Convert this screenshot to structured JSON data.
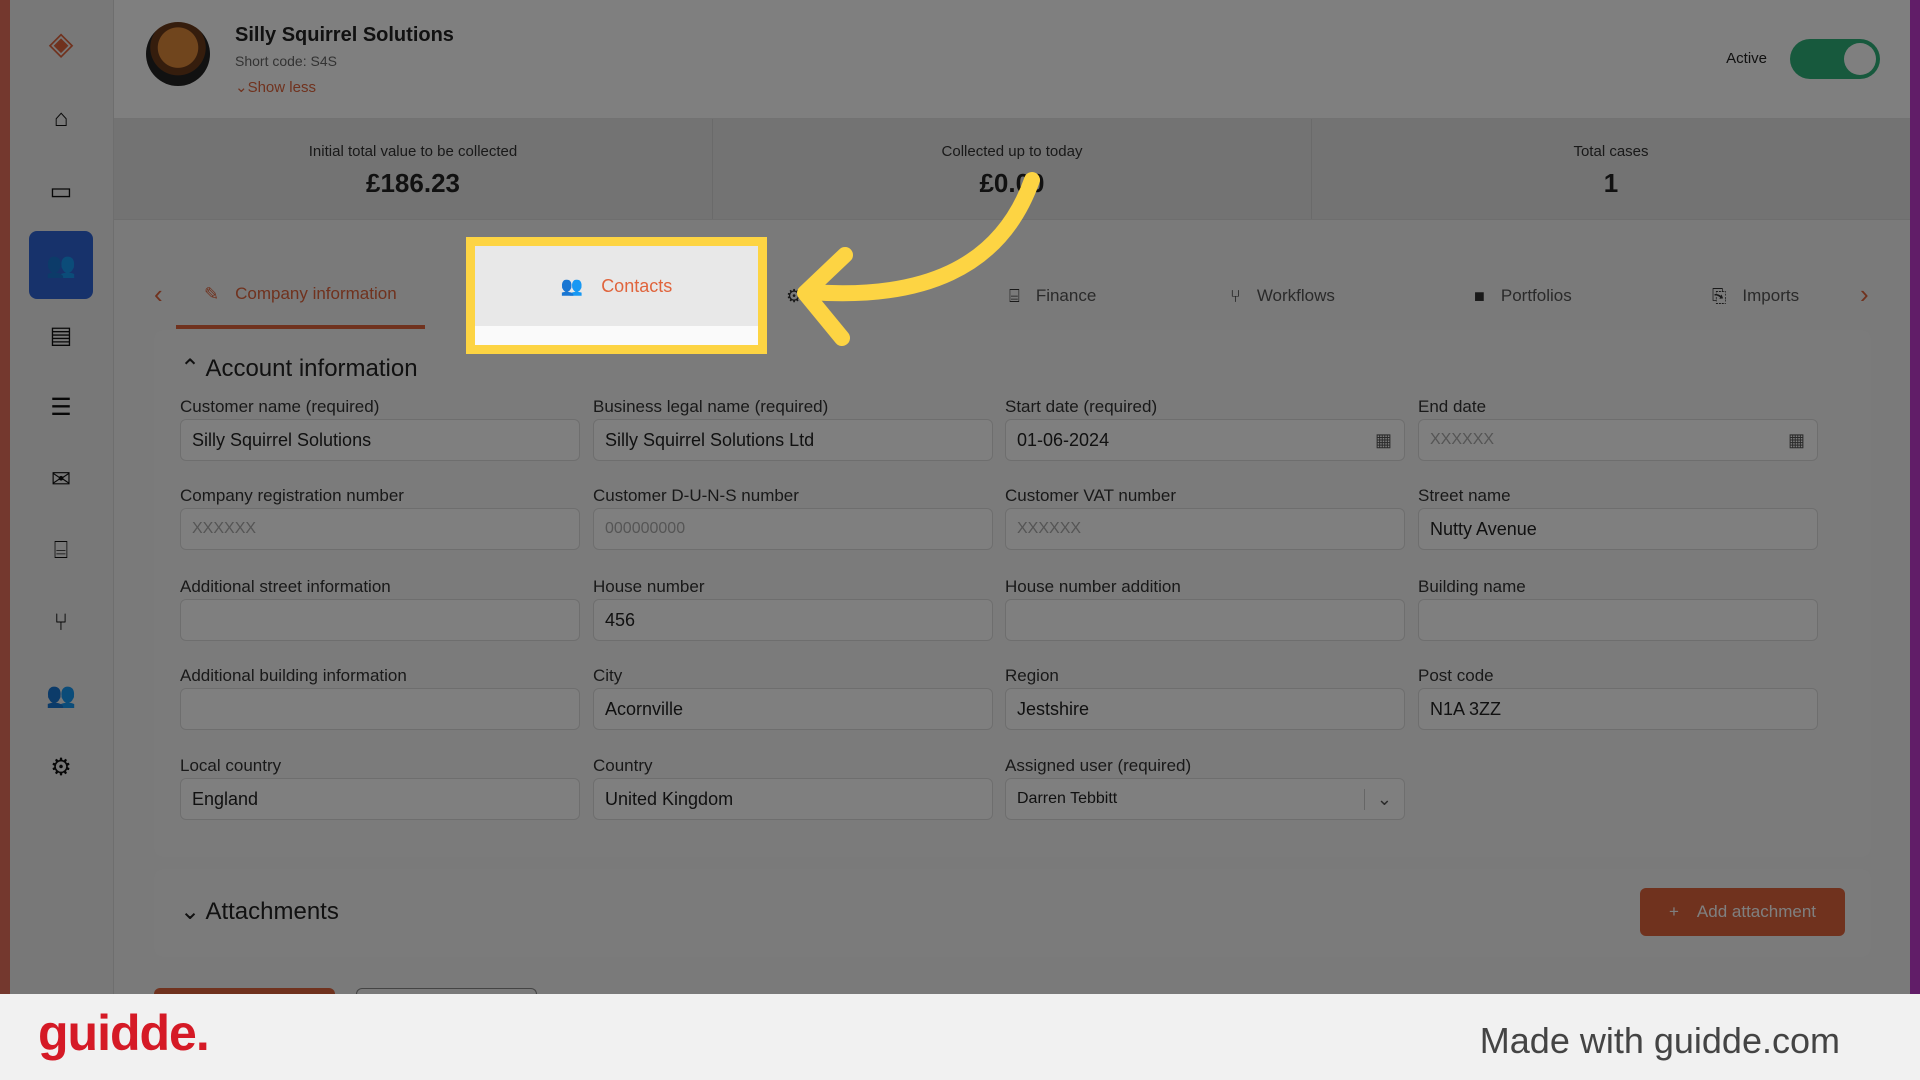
{
  "sidebar": {
    "items": [
      {
        "icon": "logo-icon"
      },
      {
        "icon": "home-icon"
      },
      {
        "icon": "ticket-icon"
      },
      {
        "icon": "users-icon",
        "active": true
      },
      {
        "icon": "contact-card-icon"
      },
      {
        "icon": "database-icon"
      },
      {
        "icon": "envelope-icon"
      },
      {
        "icon": "bank-icon"
      },
      {
        "icon": "branch-icon"
      },
      {
        "icon": "user-group-icon"
      },
      {
        "icon": "gear-icon"
      }
    ]
  },
  "header": {
    "company_name": "Silly Squirrel Solutions",
    "short_code": "Short code: S4S",
    "show_less": "Show less",
    "status_label": "Active",
    "status_on": true
  },
  "stats": [
    {
      "label": "Initial total value to be collected",
      "value": "£186.23"
    },
    {
      "label": "Collected up to today",
      "value": "£0.00"
    },
    {
      "label": "Total cases",
      "value": "1"
    }
  ],
  "tabs": [
    {
      "label": "Company information",
      "icon": "edit-doc-icon",
      "selected": true
    },
    {
      "label": "Contacts",
      "icon": "users-gear-icon"
    },
    {
      "label": "",
      "icon": "gear-icon"
    },
    {
      "label": "Finance",
      "icon": "bank-icon"
    },
    {
      "label": "Workflows",
      "icon": "branch-icon"
    },
    {
      "label": "Portfolios",
      "icon": "folder-icon"
    },
    {
      "label": "Imports",
      "icon": "file-import-icon"
    }
  ],
  "account": {
    "title": "Account information",
    "fields": [
      {
        "label": "Customer name (required)",
        "value": "Silly Squirrel Solutions"
      },
      {
        "label": "Business legal name (required)",
        "value": "Silly Squirrel Solutions Ltd"
      },
      {
        "label": "Start date (required)",
        "value": "01-06-2024"
      },
      {
        "label": "End date",
        "placeholder": "XXXXXX"
      },
      {
        "label": "Company registration number",
        "placeholder": "XXXXXX"
      },
      {
        "label": "Customer D-U-N-S number",
        "placeholder": "000000000"
      },
      {
        "label": "Customer VAT number",
        "placeholder": "XXXXXX"
      },
      {
        "label": "Street name",
        "value": "Nutty Avenue"
      },
      {
        "label": "Additional street information",
        "value": ""
      },
      {
        "label": "House number",
        "value": "456"
      },
      {
        "label": "House number addition",
        "value": ""
      },
      {
        "label": "Building name",
        "value": ""
      },
      {
        "label": "Additional building information",
        "value": ""
      },
      {
        "label": "City",
        "value": "Acornville"
      },
      {
        "label": "Region",
        "value": "Jestshire"
      },
      {
        "label": "Post code",
        "value": "N1A 3ZZ"
      },
      {
        "label": "Local country",
        "value": "England"
      },
      {
        "label": "Country",
        "value": "United Kingdom"
      },
      {
        "label": "Assigned user (required)",
        "value": "Darren Tebbitt"
      }
    ]
  },
  "attachments": {
    "title": "Attachments",
    "add_label": "Add attachment"
  },
  "footer": {
    "brand": "guidde.",
    "made_with": "Made with guidde.com"
  },
  "colors": {
    "accent": "#e0643c",
    "highlight": "#fdd443",
    "sidebar_active": "#2f64d6",
    "toggle": "#2fb27a"
  }
}
